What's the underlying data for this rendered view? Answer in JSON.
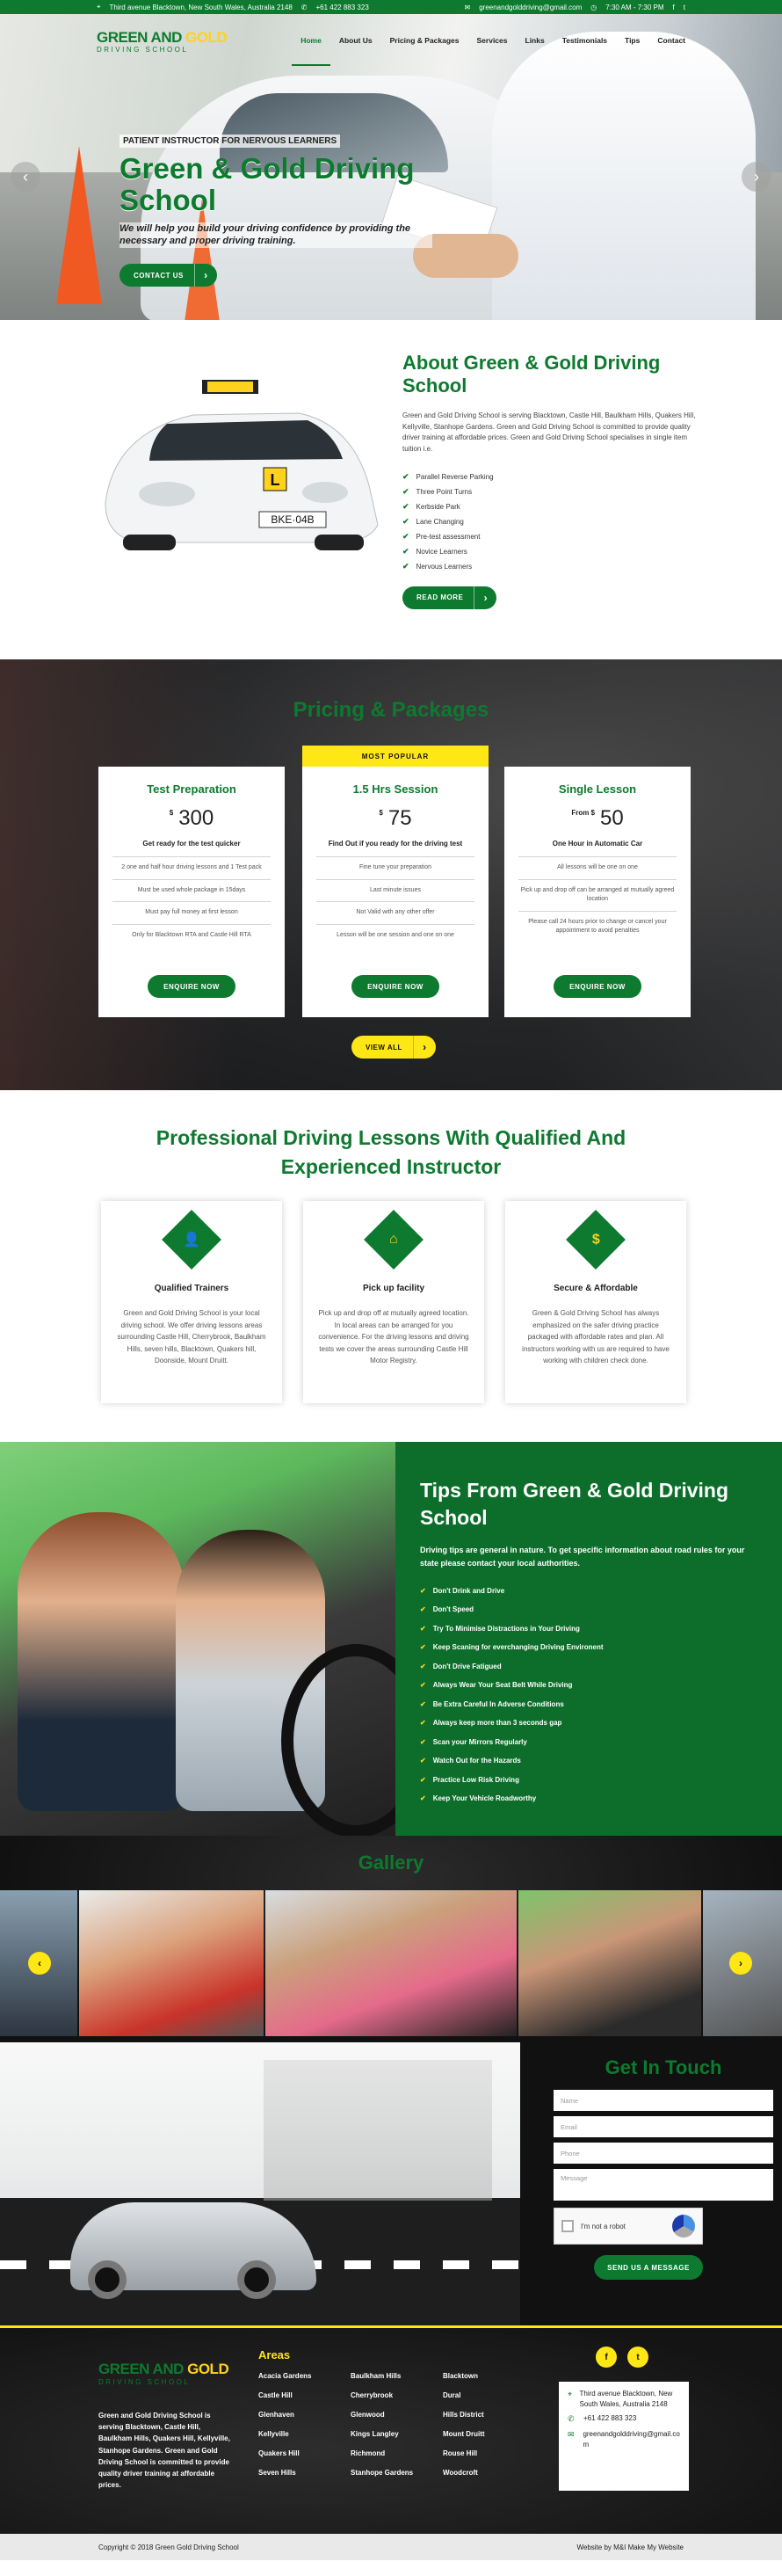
{
  "topbar": {
    "address": "Third avenue Blacktown, New South Wales, Australia 2148",
    "phone": "+61 422 883 323",
    "email": "greenandgolddriving@gmail.com",
    "hours": "7:30 AM - 7:30 PM",
    "social": [
      "f",
      "t"
    ]
  },
  "logo": {
    "green": "GREEN AND ",
    "gold": "GOLD",
    "sub": "DRIVING SCHOOL"
  },
  "nav": {
    "items": [
      "Home",
      "About Us",
      "Pricing & Packages",
      "Services",
      "Links",
      "Testimonials",
      "Tips",
      "Contact"
    ]
  },
  "hero": {
    "kicker": "PATIENT INSTRUCTOR FOR NERVOUS LEARNERS",
    "title": "Green & Gold Driving School",
    "text": "We will help you build your driving confidence by providing the necessary and proper driving training.",
    "button": "CONTACT US",
    "prev": "‹",
    "next": "›"
  },
  "about": {
    "title": "About Green & Gold Driving School",
    "desc": "Green and Gold Driving School is serving Blacktown, Castle Hill, Baulkham Hills, Quakers Hill, Kellyville, Stanhope Gardens. Green and Gold Driving School is committed to provide quality driver training at affordable prices. Green and Gold Driving School specialises in single item tuition i.e.",
    "items": [
      "Parallel Reverse Parking",
      "Three Point Turns",
      "Kerbside Park",
      "Lane Changing",
      "Pre-test assessment",
      "Novice Learners",
      "Nervous Learners"
    ],
    "button": "READ MORE",
    "plate": "BKE·04B"
  },
  "pricing": {
    "title": "Pricing & Packages",
    "popular": "MOST POPULAR",
    "plans": [
      {
        "name": "Test Preparation",
        "prefix": "$",
        "price": "300",
        "sub": "Get ready for the test quicker",
        "rows": [
          "2 one and half hour driving lessons and 1 Test pack",
          "Must be used whole package in 15days",
          "Must pay full money at first lesson",
          "Only for Blacktown RTA and Castle Hill RTA"
        ],
        "button": "ENQUIRE NOW"
      },
      {
        "name": "1.5 Hrs Session",
        "prefix": "$",
        "price": "75",
        "sub": "Find Out if you ready for the driving test",
        "rows": [
          "Fine tune your preparation",
          "Last minute issues",
          "Not Valid with any other offer",
          "Lesson will be one session and one on one"
        ],
        "button": "ENQUIRE NOW"
      },
      {
        "name": "Single Lesson",
        "prefix": "From $",
        "price": "50",
        "sub": "One Hour in Automatic Car",
        "rows": [
          "All lessons will be one on one",
          "Pick up and drop off can be arranged at mutually agreed location",
          "Please call 24 hours prior to change or cancel your appointment to avoid penalties"
        ],
        "button": "ENQUIRE NOW"
      }
    ],
    "view_all": "VIEW ALL"
  },
  "professional": {
    "title": "Professional Driving Lessons With Qualified And Experienced Instructor",
    "features": [
      {
        "icon": "👤",
        "title": "Qualified Trainers",
        "text": "Green and Gold Driving School is your local driving school. We offer driving lessons areas surrounding Castle Hill, Cherrybrook, Baulkham Hills, seven hills, Blacktown, Quakers hill, Doonside, Mount Druitt."
      },
      {
        "icon": "⌂",
        "title": "Pick up facility",
        "text": "Pick up and drop off at mutually agreed location. In local areas can be arranged for you convenience. For the driving lessons and driving tests we cover the areas surrounding Castle Hill Motor Registry."
      },
      {
        "icon": "$",
        "title": "Secure & Affordable",
        "text": "Green & Gold Driving School has always emphasized on the safer driving practice packaged with affordable rates and plan. All instructors working with us are required to have working with children check done."
      }
    ]
  },
  "tips": {
    "title": "Tips From Green & Gold Driving School",
    "intro": "Driving tips are general in nature. To get specific information about road rules for your state please contact your local authorities.",
    "items": [
      "Don't Drink and Drive",
      "Don't Speed",
      "Try To Minimise Distractions in Your Driving",
      "Keep Scaning for everchanging Driving Environent",
      "Don't Drive Fatigued",
      "Always Wear Your Seat Belt While Driving",
      "Be Extra Careful In Adverse Conditions",
      "Always keep more than 3 seconds gap",
      "Scan your Mirrors Regularly",
      "Watch Out for the Hazards",
      "Practice Low Risk Driving",
      "Keep Your Vehicle Roadworthy"
    ]
  },
  "gallery": {
    "title": "Gallery",
    "prev": "‹",
    "next": "›"
  },
  "contact": {
    "title": "Get In Touch",
    "name": "Name",
    "email": "Email",
    "phone": "Phone",
    "message": "Message",
    "captcha": "I'm not a robot",
    "button": "SEND US A MESSAGE"
  },
  "footer": {
    "desc": "Green and Gold Driving School is serving Blacktown, Castle Hill, Baulkham Hills, Quakers Hill, Kellyville, Stanhope Gardens. Green and Gold Driving School is committed to provide quality driver training at affordable prices.",
    "areas_title": "Areas",
    "areas": [
      "Acacia Gardens",
      "Baulkham Hills",
      "Blacktown",
      "Castle Hill",
      "Cherrybrook",
      "Dural",
      "Glenhaven",
      "Glenwood",
      "Hills District",
      "Kellyville",
      "Kings Langley",
      "Mount Druitt",
      "Quakers Hill",
      "Richmond",
      "Rouse Hill",
      "Seven Hills",
      "Stanhope Gardens",
      "Woodcroft"
    ],
    "social": [
      "f",
      "t"
    ],
    "address": "Third avenue Blacktown, New South Wales, Australia 2148",
    "phone": "+61 422 883 323",
    "email": "greenandgolddriving@gmail.com",
    "copyright": "Copyright © 2018 Green Gold Driving School",
    "credit": "Website by M&I Make My Website"
  },
  "colors": {
    "brand_green": "#0d7a2f",
    "accent_yellow": "#ffe615"
  }
}
